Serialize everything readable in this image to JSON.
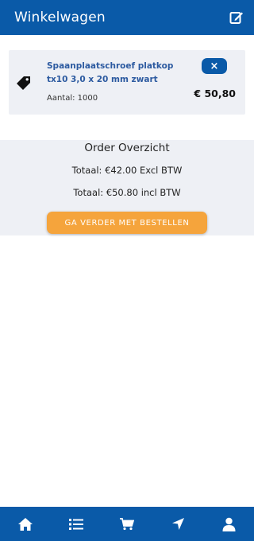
{
  "header": {
    "title": "Winkelwagen",
    "edit_icon": "edit-note-icon"
  },
  "cart": {
    "items": [
      {
        "name": "Spaanplaatschroef platkop tx10 3,0 x 20 mm zwart",
        "quantity": "Aantal: 1000",
        "price": "€ 50,80",
        "remove_label": "×",
        "icon": "tag-icon"
      }
    ]
  },
  "overview": {
    "title": "Order Overzicht",
    "total_excl": "Totaal: €42.00 Excl BTW",
    "total_incl": "Totaal: €50.80 incl BTW",
    "continue_button": "GA VERDER MET BESTELLEN"
  },
  "bottom_nav": [
    {
      "icon": "home-icon"
    },
    {
      "icon": "list-icon"
    },
    {
      "icon": "cart-icon"
    },
    {
      "icon": "navigation-icon"
    },
    {
      "icon": "user-icon"
    }
  ],
  "colors": {
    "primary": "#0a5aa8",
    "accent": "#f5a43c",
    "panel": "#eef0f5",
    "product_name": "#2c5aa0"
  }
}
